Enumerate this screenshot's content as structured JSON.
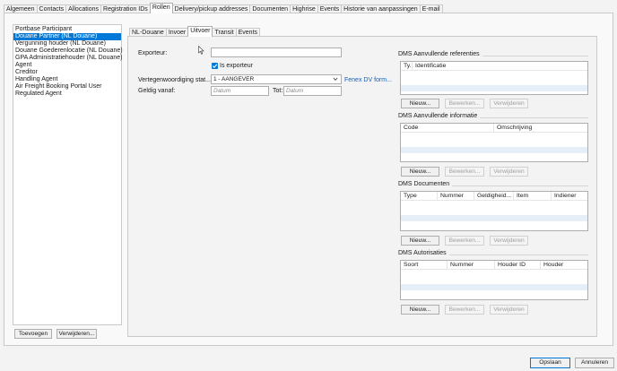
{
  "main_tabs": [
    "Algemeen",
    "Contacts",
    "Allocations",
    "Registration IDs",
    "Rollen",
    "Delivery/pickup addresses",
    "Documenten",
    "Highrise",
    "Events",
    "Historie van aanpassingen",
    "E-mail"
  ],
  "roles_list": [
    "Portbase Participant",
    "Douane Partner (NL Douane)",
    "Vergunning houder (NL Douane)",
    "Douane Goederenlocatie (NL Douane)",
    "GPA Administratiehouder (NL Douane)",
    "Agent",
    "Creditor",
    "Handling Agent",
    "Air Freight Booking Portal User",
    "Regulated Agent"
  ],
  "left_buttons": {
    "add": "Toevoegen",
    "remove": "Verwijderen..."
  },
  "sub_tabs": [
    "NL-Douane",
    "Invoer",
    "Uitvoer",
    "Transit",
    "Events"
  ],
  "form": {
    "exporteur_label": "Exporteur:",
    "exporteur_value": "",
    "is_exporteur_label": "Is exporteur",
    "vertegenwoordiging_label": "Vertegenwoordiging stat...",
    "vertegenwoordiging_value": "1 - AANGEVER",
    "fenex_link": "Fenex DV form...",
    "geldig_label": "Geldig vanaf:",
    "datum_placeholder": "Datum",
    "tot_label": "Tot:"
  },
  "sections": {
    "referenties": {
      "title": "DMS Aanvullende referenties",
      "columns": [
        "Ty...",
        "Identificatie"
      ]
    },
    "informatie": {
      "title": "DMS Aanvullende informatie",
      "columns": [
        "Code",
        "Omschrijving"
      ]
    },
    "documenten": {
      "title": "DMS Documenten",
      "columns": [
        "Type",
        "Nummer",
        "Geldigheid...",
        "Item",
        "Indiener"
      ]
    },
    "autorisaties": {
      "title": "DMS Autorisaties",
      "columns": [
        "Soort",
        "Nummer",
        "Houder ID",
        "Houder"
      ]
    }
  },
  "section_buttons": {
    "new": "Nieuw...",
    "edit": "Bewerken...",
    "delete": "Verwijderen"
  },
  "footer": {
    "save": "Opslaan",
    "cancel": "Annuleren"
  },
  "colors": {
    "selection": "#0078d7",
    "link": "#1560b8"
  }
}
